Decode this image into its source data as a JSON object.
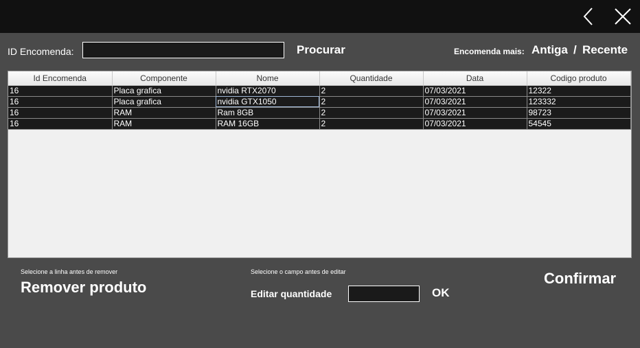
{
  "window": {
    "back_icon": "chevron-left-icon",
    "close_icon": "close-icon"
  },
  "search": {
    "label": "ID Encomenda:",
    "value": "",
    "button_label": "Procurar"
  },
  "sort": {
    "label": "Encomenda mais:",
    "oldest": "Antiga",
    "separator": "/",
    "newest": "Recente"
  },
  "table": {
    "columns": [
      "Id Encomenda",
      "Componente",
      "Nome",
      "Quantidade",
      "Data",
      "Codigo produto"
    ],
    "rows": [
      [
        "16",
        "Placa grafica",
        "nvidia RTX2070",
        "2",
        "07/03/2021",
        "12322"
      ],
      [
        "16",
        "Placa grafica",
        "nvidia GTX1050",
        "2",
        "07/03/2021",
        "123332"
      ],
      [
        "16",
        "RAM",
        "Ram 8GB",
        "2",
        "07/03/2021",
        "98723"
      ],
      [
        "16",
        "RAM",
        "RAM 16GB",
        "2",
        "07/03/2021",
        "54545"
      ]
    ]
  },
  "remove": {
    "hint": "Selecione a linha antes de remover",
    "button_label": "Remover produto"
  },
  "edit": {
    "hint": "Selecione o campo antes de editar",
    "label": "Editar quantidade",
    "value": "",
    "ok_label": "OK"
  },
  "confirm": {
    "button_label": "Confirmar"
  },
  "colors": {
    "background": "#4a4a4a",
    "topbar": "#111111",
    "row_background": "#1b1b1b",
    "table_background": "#f0f0f0"
  }
}
